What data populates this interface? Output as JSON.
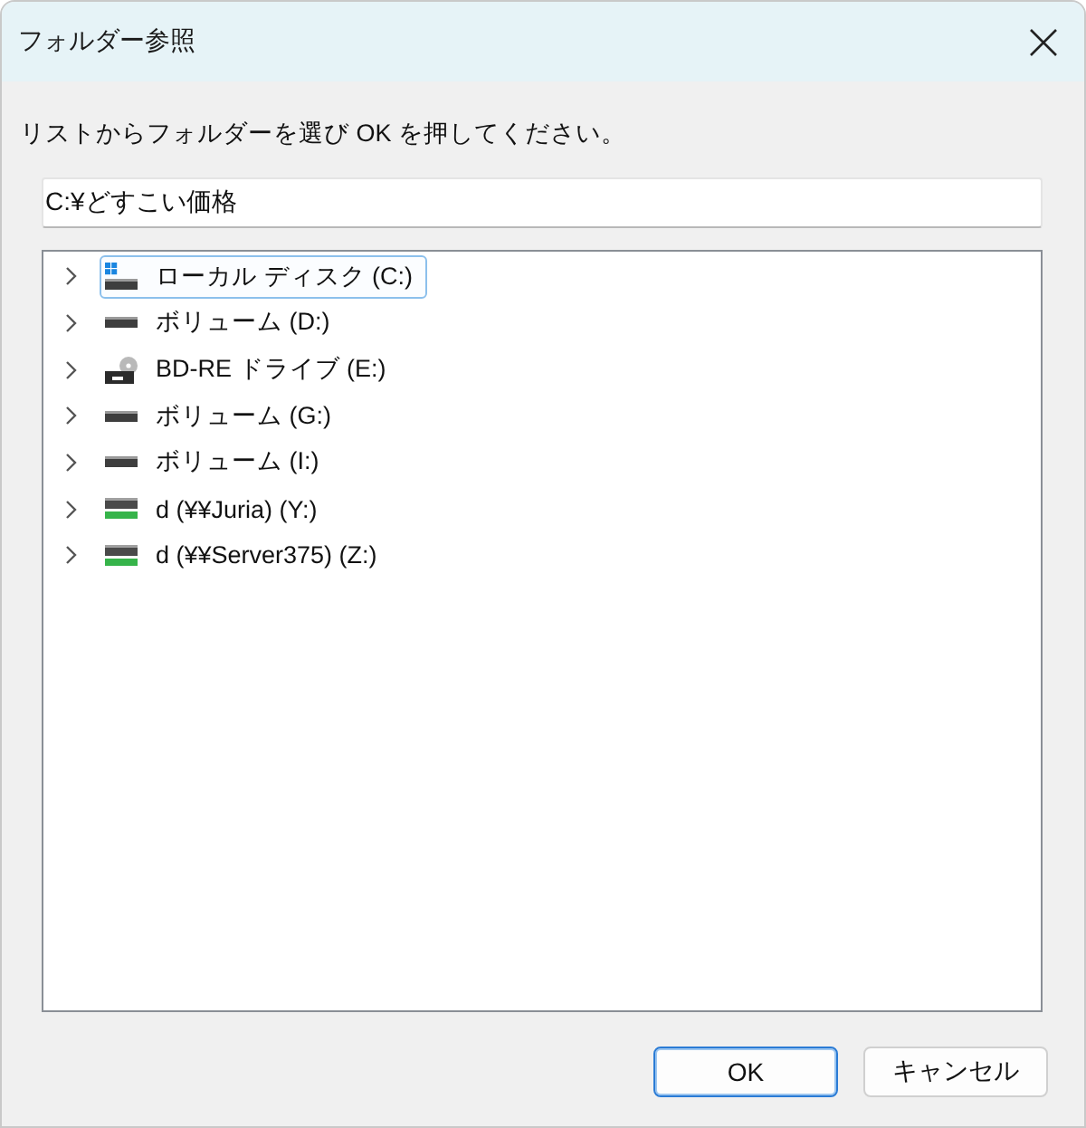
{
  "window": {
    "title": "フォルダー参照"
  },
  "instruction": "リストからフォルダーを選び OK を押してください。",
  "path_field": {
    "value": "C:¥どすこい価格"
  },
  "tree": {
    "items": [
      {
        "label": "ローカル ディスク (C:)",
        "kind": "local-disk",
        "selected": true,
        "expanded": false
      },
      {
        "label": "ボリューム (D:)",
        "kind": "volume",
        "selected": false,
        "expanded": false
      },
      {
        "label": "BD-RE ドライブ (E:)",
        "kind": "optical-drive",
        "selected": false,
        "expanded": false
      },
      {
        "label": "ボリューム (G:)",
        "kind": "volume",
        "selected": false,
        "expanded": false
      },
      {
        "label": "ボリューム (I:)",
        "kind": "volume",
        "selected": false,
        "expanded": false
      },
      {
        "label": "d (¥¥Juria) (Y:)",
        "kind": "network-drive",
        "selected": false,
        "expanded": false
      },
      {
        "label": "d (¥¥Server375) (Z:)",
        "kind": "network-drive",
        "selected": false,
        "expanded": false
      }
    ]
  },
  "buttons": [
    {
      "label": "OK",
      "default": true
    },
    {
      "label": "キャンセル",
      "default": false
    }
  ]
}
